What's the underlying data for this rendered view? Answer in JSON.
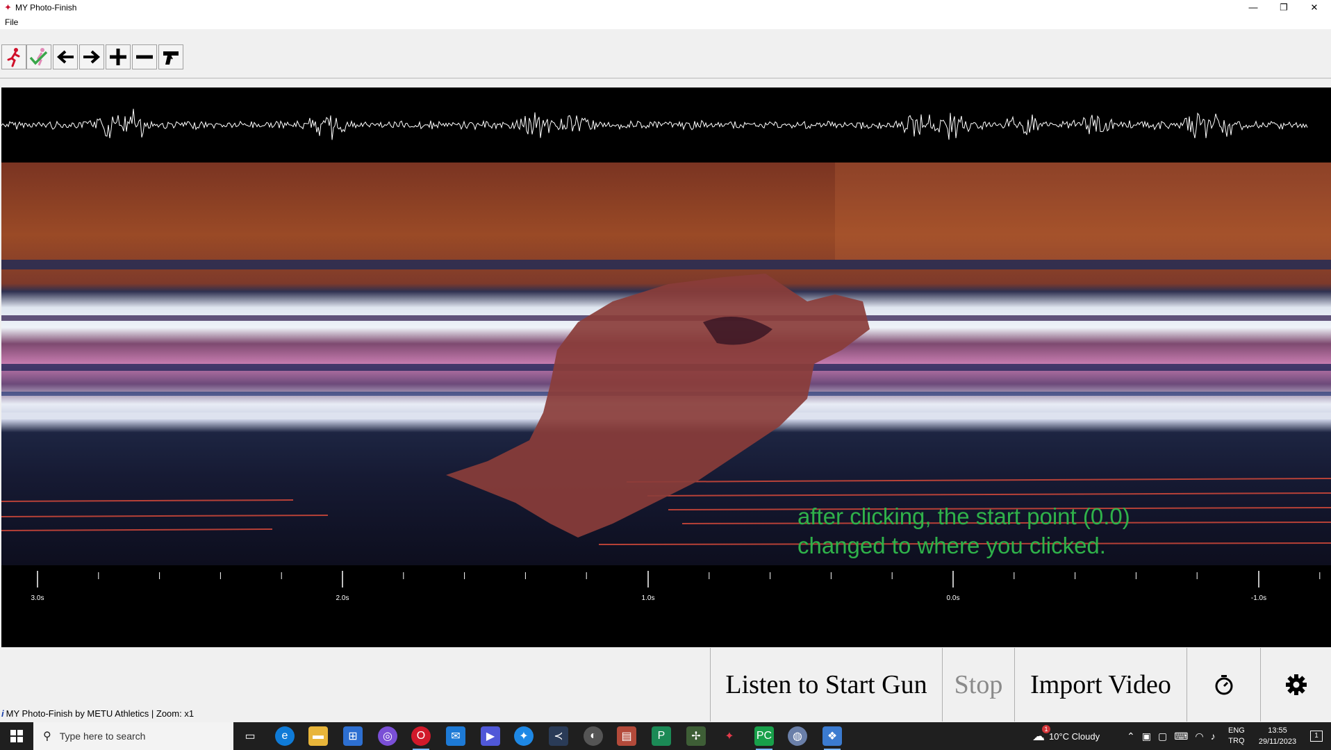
{
  "window": {
    "title": "MY Photo-Finish",
    "minimize": "—",
    "restore": "❐",
    "close": "✕"
  },
  "menu": {
    "file": "File"
  },
  "toolbar": {
    "tools": [
      {
        "name": "runner-tool",
        "icon": "runner-icon"
      },
      {
        "name": "check-tool",
        "icon": "check-icon"
      },
      {
        "name": "left-tool",
        "icon": "arrow-left-icon"
      },
      {
        "name": "right-tool",
        "icon": "arrow-right-icon"
      },
      {
        "name": "zoom-in-tool",
        "icon": "plus-icon"
      },
      {
        "name": "zoom-out-tool",
        "icon": "minus-icon"
      },
      {
        "name": "gun-tool",
        "icon": "gun-icon"
      }
    ]
  },
  "canvas": {
    "annotation_line1": "after clicking, the start point (0.0)",
    "annotation_line2": "changed to where you clicked.",
    "scale_labels": [
      "3.0s",
      "2.0s",
      "1.0s",
      "0.0s",
      "-1.0s"
    ]
  },
  "actions": {
    "listen": "Listen to Start Gun",
    "stop": "Stop",
    "import": "Import Video",
    "timer_icon": "stopwatch-icon",
    "settings_icon": "gear-icon"
  },
  "status": {
    "text": "MY Photo-Finish by METU Athletics  | Zoom: x1"
  },
  "taskbar": {
    "search_placeholder": "Type here to search",
    "weather": "10°C  Cloudy",
    "lang_top": "ENG",
    "lang_bottom": "TRQ",
    "time": "13:55",
    "date": "29/11/2023",
    "notification_count": "1",
    "weather_badge": "1"
  },
  "colors": {
    "annotation": "#2fb24a",
    "taskbar": "#1f1f1f",
    "accent": "#7cb7ff"
  }
}
